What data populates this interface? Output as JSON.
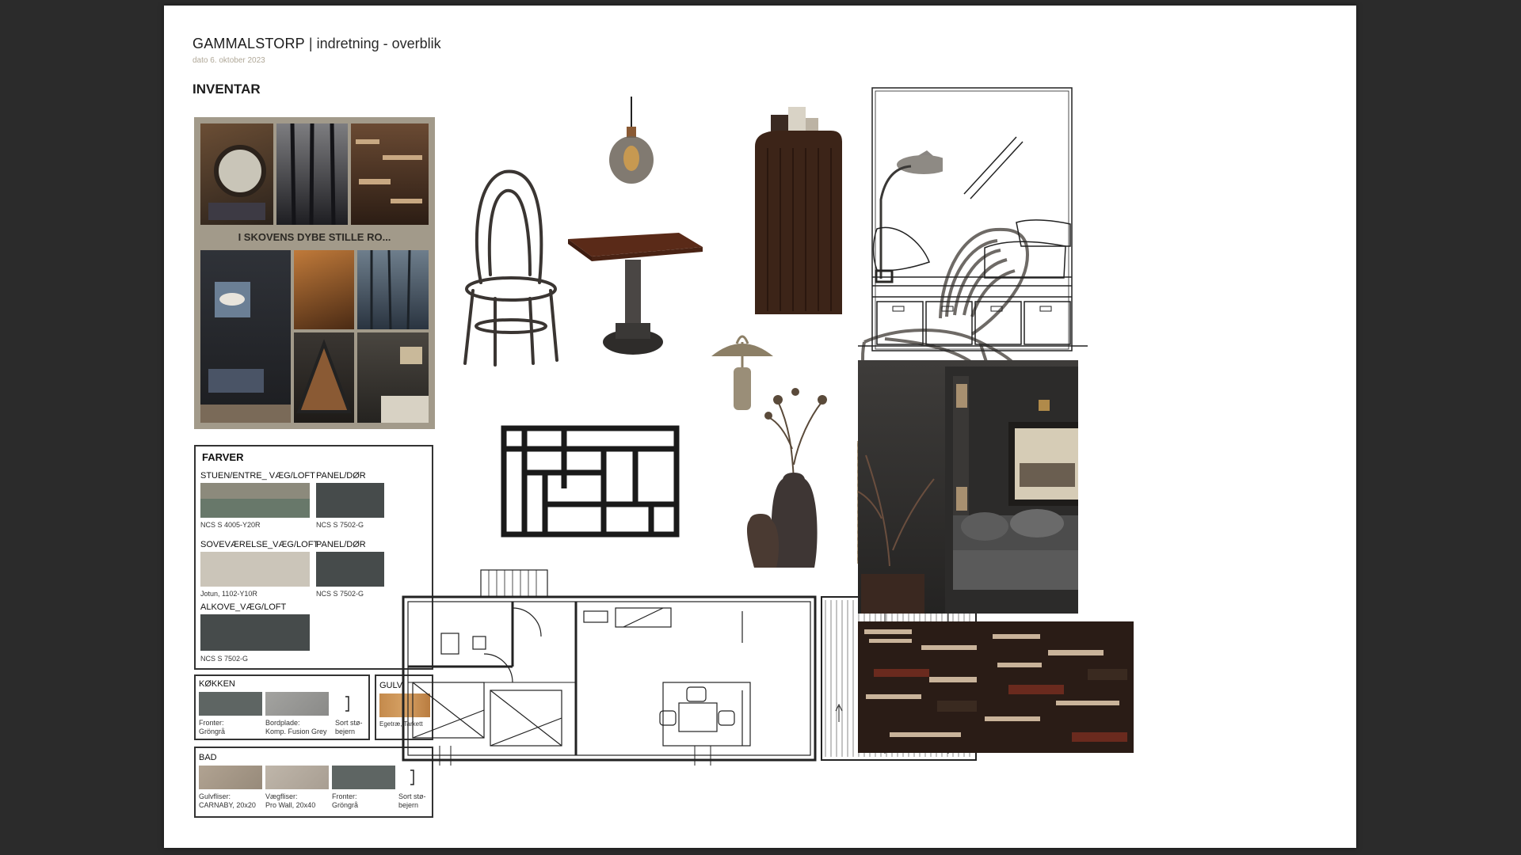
{
  "header": {
    "title_bold": "GAMMALSTORP",
    "title_sep": " | ",
    "title_rest": "indretning - overblik",
    "date": "dato 6. oktober 2023",
    "section": "INVENTAR"
  },
  "moodboard": {
    "caption": "I SKOVENS DYBE STILLE RO..."
  },
  "farver": {
    "heading": "FARVER",
    "items": [
      {
        "label": "STUEN/ENTRE_ VÆG/LOFT",
        "code": "NCS S 4005-Y20R",
        "color": "#8a8f83"
      },
      {
        "label": "PANEL/DØR",
        "code": "NCS S 7502-G",
        "color": "#464b4b"
      },
      {
        "label": "SOVEVÆRELSE_VÆG/LOFT",
        "code": "Jotun, 1102-Y10R",
        "color": "#cbc5b9"
      },
      {
        "label": "PANEL/DØR",
        "code": "NCS S 7502-G",
        "color": "#464b4b"
      },
      {
        "label": "ALKOVE_VÆG/LOFT",
        "code": "NCS S 7502-G",
        "color": "#464b4b"
      }
    ]
  },
  "kokken": {
    "heading": "KØKKEN",
    "items": [
      {
        "line1": "Fronter:",
        "line2": "Gröngrå",
        "color": "#5e6563"
      },
      {
        "line1": "Bordplade:",
        "line2": "Komp. Fusion Grey",
        "color": "#9b9b98"
      },
      {
        "line1": "Sort stø-",
        "line2": "bejern",
        "color": "#ffffff"
      }
    ]
  },
  "gulv": {
    "heading": "GULV",
    "line1": "Egetræ, Tarkett",
    "color": "#c08a4e"
  },
  "bad": {
    "heading": "BAD",
    "items": [
      {
        "line1": "Gulvfliser:",
        "line2": "CARNABY, 20x20",
        "color": "#a89b8b"
      },
      {
        "line1": "Vægfliser:",
        "line2": "Pro Wall, 20x40",
        "color": "#b5aca0"
      },
      {
        "line1": "Fronter:",
        "line2": "Gröngrå",
        "color": "#5e6563"
      },
      {
        "line1": "Sort stø-",
        "line2": "bejern",
        "color": "#ffffff"
      }
    ]
  }
}
